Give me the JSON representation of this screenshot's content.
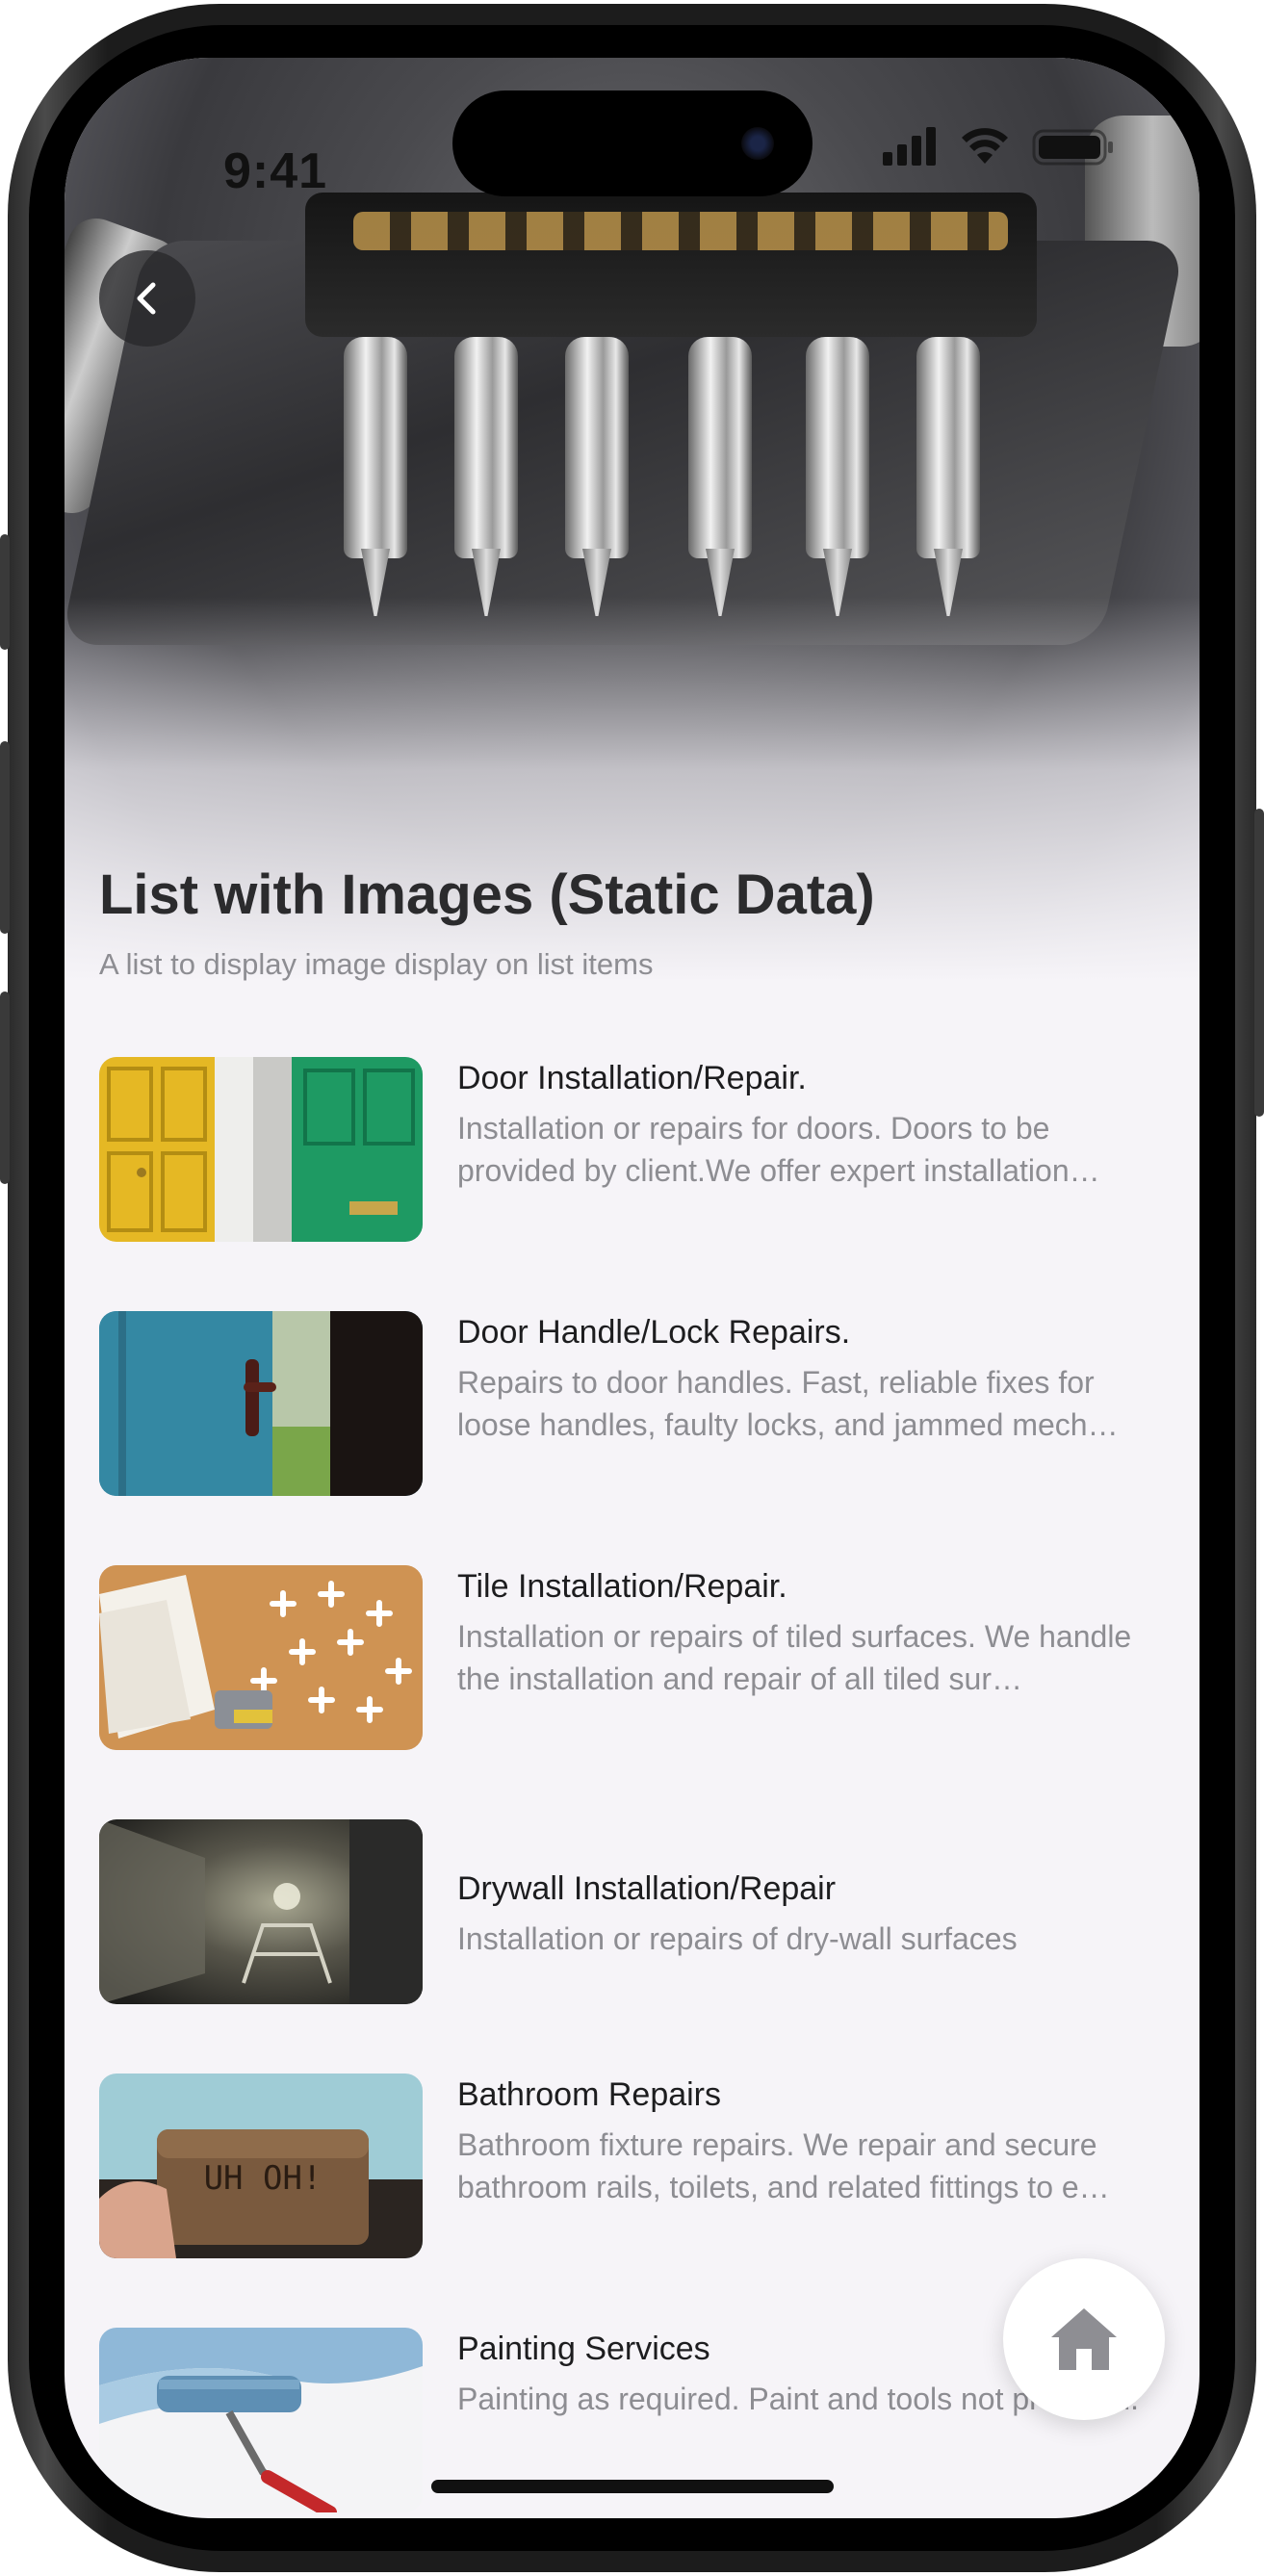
{
  "status_bar": {
    "time": "9:41",
    "icons": [
      "signal-icon",
      "wifi-icon",
      "battery-icon"
    ]
  },
  "header": {
    "back_icon": "chevron-left-icon",
    "title": "List with Images (Static Data)",
    "subtitle": "A list to display image display on list items"
  },
  "list": {
    "items": [
      {
        "title": "Door Installation/Repair.",
        "description": "Installation or repairs for doors. Doors to be provided by client.We offer expert installation…"
      },
      {
        "title": "Door Handle/Lock Repairs.",
        "description": "Repairs to door handles. Fast, reliable fixes for loose handles, faulty locks, and jammed mech…"
      },
      {
        "title": "Tile Installation/Repair.",
        "description": "Installation or repairs of tiled surfaces.  We handle the installation and repair of all tiled sur…"
      },
      {
        "title": "Drywall Installation/Repair",
        "description": "Installation or repairs of dry-wall surfaces"
      },
      {
        "title": "Bathroom Repairs",
        "description": "Bathroom fixture repairs. We repair and secure bathroom rails, toilets, and related fittings to e…",
        "image_text": "UH OH!"
      },
      {
        "title": "Painting Services",
        "description": "Painting as required. Paint and tools not provided."
      }
    ]
  },
  "fab": {
    "icon": "home-icon"
  },
  "colors": {
    "background": "#f6f4f8",
    "title": "#2b2b2d",
    "secondary_text": "#8d8d92",
    "fab_icon": "#8e8e93"
  }
}
